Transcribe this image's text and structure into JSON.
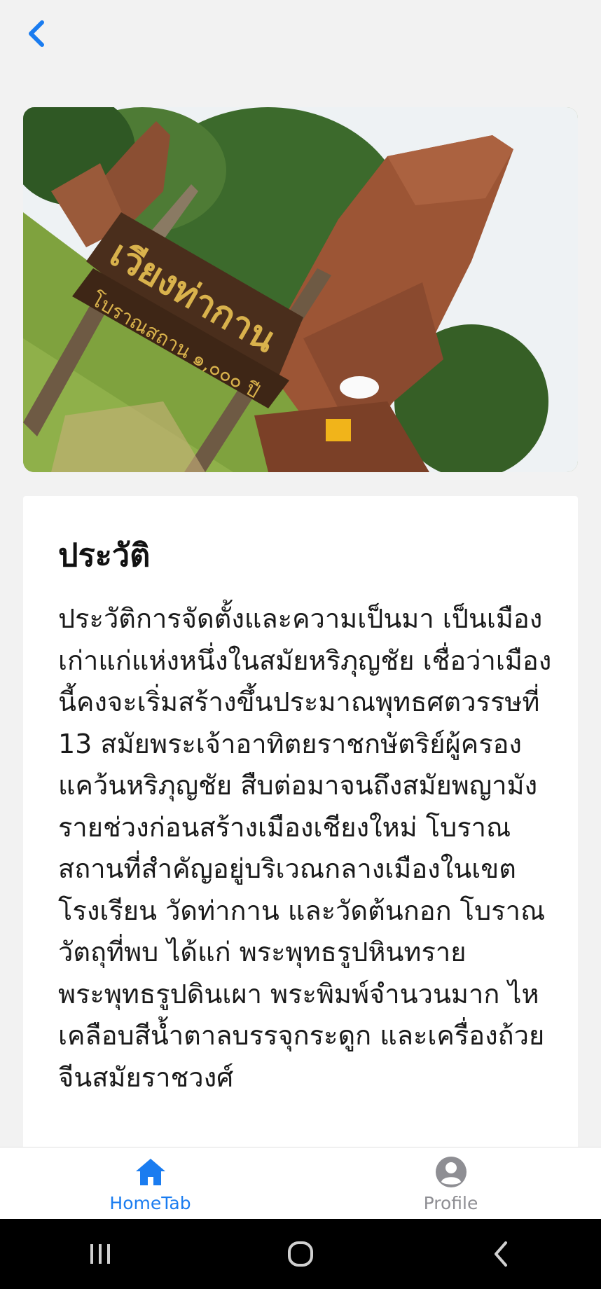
{
  "header": {
    "back_icon": "chevron-left-icon",
    "accent_color": "#1a7cf0"
  },
  "hero_image": {
    "description_icon": "temple-photo",
    "sign_text_main": "เวียงท่ากาน",
    "sign_text_sub": "โบราณสถาน ๑,๐๐๐ ปี"
  },
  "section": {
    "title": "ประวัติ",
    "body": "ประวัติการจัดตั้งและความเป็นมา เป็นเมืองเก่าแก่แห่งหนึ่งในสมัยหริภุญชัย เชื่อว่าเมืองนี้คงจะเริ่มสร้างขึ้นประมาณพุทธศตวรรษที่ 13 สมัยพระเจ้าอาทิตยราชกษัตริย์ผู้ครองแคว้นหริภุญชัย สืบต่อมาจนถึงสมัยพญามังรายช่วงก่อนสร้างเมืองเชียงใหม่ โบราณสถานที่สำคัญอยู่บริเวณกลางเมืองในเขตโรงเรียน วัดท่ากาน และวัดต้นกอก โบราณวัตถุที่พบ ได้แก่ พระพุทธรูปหินทราย พระพุทธรูปดินเผา พระพิมพ์จำนวนมาก ไหเคลือบสีน้ำตาลบรรจุกระดูก และเครื่องถ้วยจีนสมัยราชวงศ์"
  },
  "tabs": [
    {
      "label": "HomeTab",
      "icon": "home-icon",
      "active": true,
      "color": "#1a7cf0"
    },
    {
      "label": "Profile",
      "icon": "user-circle-icon",
      "active": false,
      "color": "#8e8e93"
    }
  ],
  "system_nav": {
    "recents_icon": "recents-icon",
    "home_icon": "home-circle-icon",
    "back_icon": "back-arrow-icon"
  }
}
